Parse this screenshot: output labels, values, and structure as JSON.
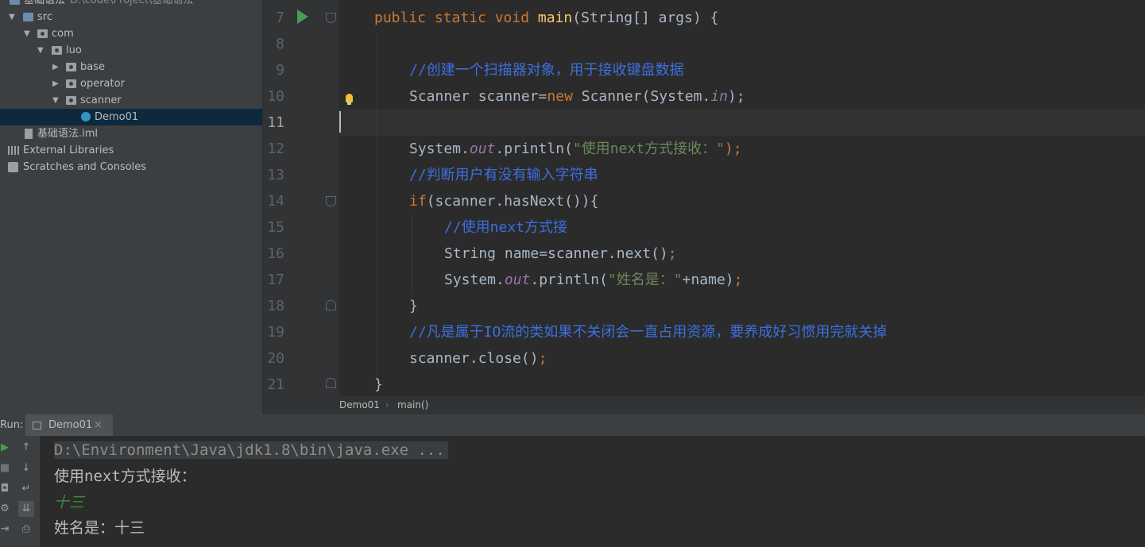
{
  "project_tree": {
    "root": {
      "label": "基础语法",
      "path_hint": "D:\\code\\Project\\基础语法"
    },
    "items": [
      {
        "label": "src"
      },
      {
        "label": "com"
      },
      {
        "label": "luo"
      },
      {
        "label": "base"
      },
      {
        "label": "operator"
      },
      {
        "label": "scanner"
      },
      {
        "label": "Demo01"
      },
      {
        "label": "基础语法.iml"
      },
      {
        "label": "External Libraries"
      },
      {
        "label": "Scratches and Consoles"
      }
    ]
  },
  "editor": {
    "line_numbers": [
      "7",
      "8",
      "9",
      "10",
      "11",
      "12",
      "13",
      "14",
      "15",
      "16",
      "17",
      "18",
      "19",
      "20",
      "21"
    ],
    "code": {
      "l7": {
        "a": "public static void ",
        "b": "main",
        "c": "(String[] args) {"
      },
      "l9": "//创建一个扫描器对象，用于接收键盘数据",
      "l10": {
        "a": "Scanner scanner=",
        "b": "new ",
        "c": "Scanner(System.",
        "d": "in",
        "e": ");"
      },
      "l12": {
        "a": "System.",
        "b": "out",
        "c": ".println(",
        "d": "\"使用next方式接收：\"",
        "e": ");"
      },
      "l13": "//判断用户有没有输入字符串",
      "l14": {
        "a": "if",
        "b": "(scanner.hasNext()){"
      },
      "l15": "//使用next方式接",
      "l16": {
        "a": "String name=scanner.next()",
        "b": ";"
      },
      "l17": {
        "a": "System.",
        "b": "out",
        "c": ".println(",
        "d": "\"姓名是：\"",
        "e": "+name)",
        "f": ";"
      },
      "l18": "}",
      "l19": "//凡是属于IO流的类如果不关闭会一直占用资源，要养成好习惯用完就关掉",
      "l20": {
        "a": "scanner.close()",
        "b": ";"
      },
      "l21": "}"
    }
  },
  "breadcrumb": {
    "items": [
      "Demo01",
      "main()"
    ]
  },
  "run": {
    "label": "Run:",
    "tab_label": "Demo01",
    "console": {
      "command": "D:\\Environment\\Java\\jdk1.8\\bin\\java.exe ...",
      "prompt": "使用next方式接收：",
      "input": "十三",
      "output": "姓名是：十三"
    }
  },
  "colors": {
    "keyword": "#cc7832",
    "comment": "#3d6fe0",
    "string": "#6a8759",
    "field": "#9876aa",
    "method": "#ffc66d",
    "run_green": "#499c54"
  }
}
